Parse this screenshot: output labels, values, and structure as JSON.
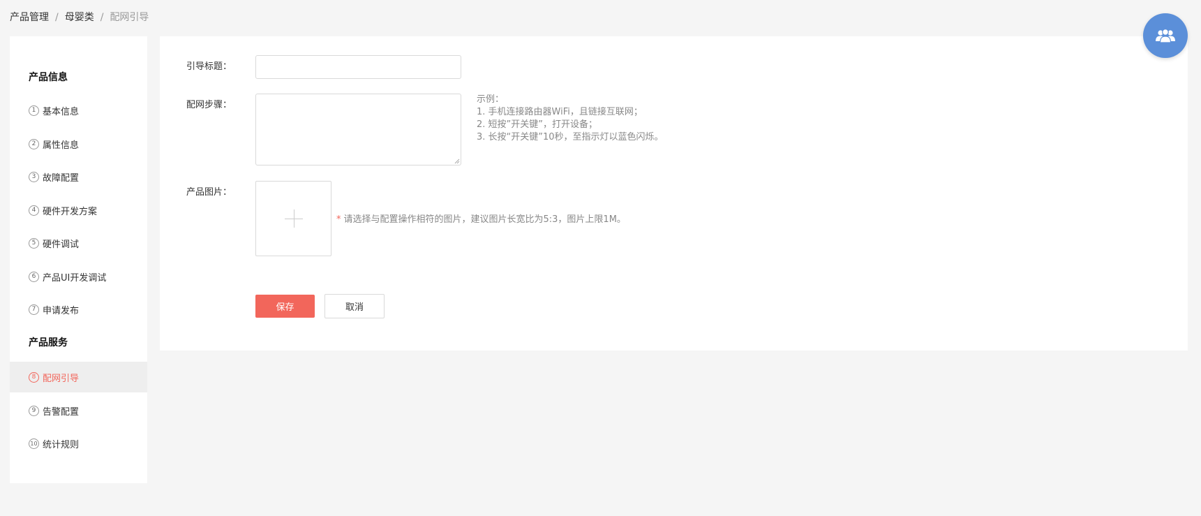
{
  "breadcrumb": {
    "items": [
      "产品管理",
      "母婴类",
      "配网引导"
    ],
    "separator": "/"
  },
  "sidebar": {
    "groups": [
      {
        "title": "产品信息"
      },
      {
        "title": "产品服务"
      }
    ],
    "items": [
      {
        "num": "1",
        "label": "基本信息"
      },
      {
        "num": "2",
        "label": "属性信息"
      },
      {
        "num": "3",
        "label": "故障配置"
      },
      {
        "num": "4",
        "label": "硬件开发方案"
      },
      {
        "num": "5",
        "label": "硬件调试"
      },
      {
        "num": "6",
        "label": "产品UI开发调试"
      },
      {
        "num": "7",
        "label": "申请发布"
      },
      {
        "num": "8",
        "label": "配网引导",
        "active": true
      },
      {
        "num": "9",
        "label": "告警配置"
      },
      {
        "num": "10",
        "label": "统计规则"
      }
    ]
  },
  "form": {
    "title_label": "引导标题：",
    "title_value": "",
    "steps_label": "配网步骤：",
    "steps_value": "",
    "example": {
      "heading": "示例：",
      "lines": [
        "1. 手机连接路由器WiFi，且链接互联网；",
        "2. 短按”开关键”，打开设备；",
        "3. 长按“开关键”10秒，至指示灯以蓝色闪烁。"
      ]
    },
    "image_label": "产品图片：",
    "upload_hint_star": "*",
    "upload_hint": "请选择与配置操作相符的图片，建议图片长宽比为5:3，图片上限1M。",
    "save_label": "保存",
    "cancel_label": "取消"
  },
  "colors": {
    "accent": "#f2665b",
    "float_button": "#5b8fd9"
  },
  "icons": {
    "upload": "plus-icon",
    "float": "users-icon"
  }
}
